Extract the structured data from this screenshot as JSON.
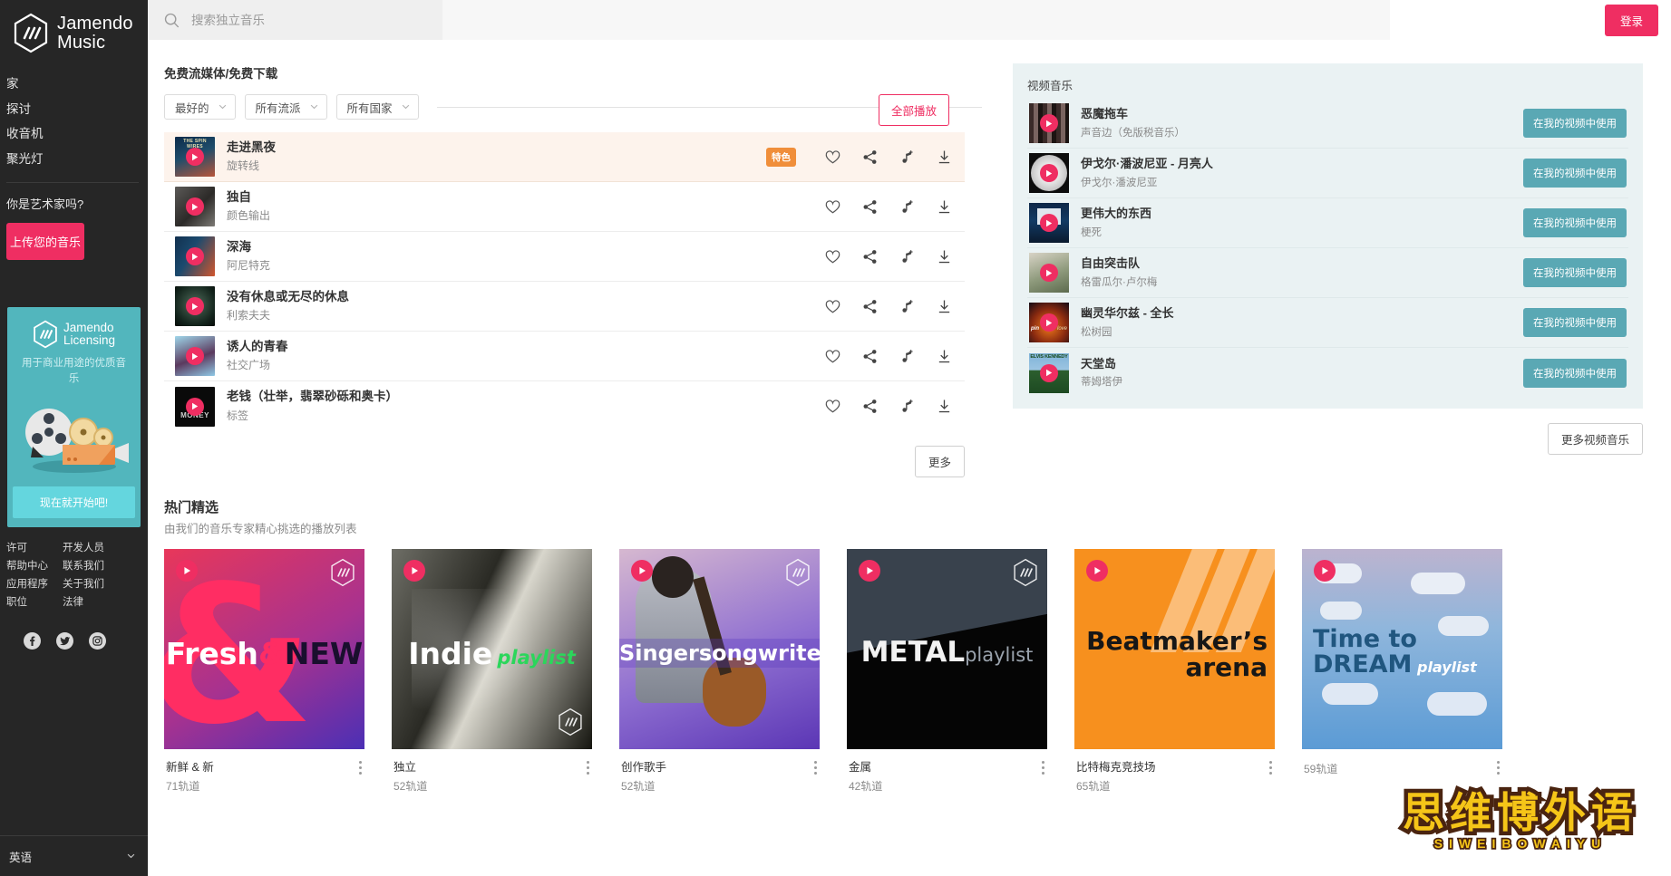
{
  "brand": {
    "line1": "Jamendo",
    "line2": "Music",
    "logo_icon": "jamendo-hex-logo"
  },
  "sidebar": {
    "nav": [
      {
        "label": "家",
        "name": "home"
      },
      {
        "label": "探讨",
        "name": "explore"
      },
      {
        "label": "收音机",
        "name": "radio"
      },
      {
        "label": "聚光灯",
        "name": "spotlight"
      }
    ],
    "artist_question": "你是艺术家吗?",
    "upload_label": "上传您的音乐",
    "promo": {
      "logo_line1": "Jamendo",
      "logo_line2": "Licensing",
      "subtitle": "用于商业用途的优质音乐",
      "cta": "现在就开始吧!"
    },
    "footer_links": [
      {
        "label": "许可"
      },
      {
        "label": "开发人员"
      },
      {
        "label": "帮助中心"
      },
      {
        "label": "联系我们"
      },
      {
        "label": "应用程序"
      },
      {
        "label": "关于我们"
      },
      {
        "label": "职位"
      },
      {
        "label": "法律"
      }
    ],
    "social": [
      {
        "name": "facebook-icon"
      },
      {
        "name": "twitter-icon"
      },
      {
        "name": "instagram-icon"
      }
    ],
    "language": "英语"
  },
  "topbar": {
    "search_placeholder": "搜索独立音乐",
    "search_value": "",
    "search_icon": "search-icon",
    "login_label": "登录"
  },
  "free_section": {
    "title": "免费流媒体/免费下载",
    "filters": [
      {
        "name": "sort",
        "value": "最好的"
      },
      {
        "name": "genre",
        "value": "所有流派"
      },
      {
        "name": "country",
        "value": "所有国家"
      }
    ],
    "play_all_label": "全部播放",
    "more_label": "更多",
    "featured_badge": "特色",
    "row_icons": [
      "heart-icon",
      "share-icon",
      "add-to-playlist-icon",
      "download-icon"
    ],
    "tracks": [
      {
        "title": "走进黑夜",
        "artist": "旋转线",
        "featured": true,
        "cover_label": "THE SPIN WIRES"
      },
      {
        "title": "独自",
        "artist": "颜色输出",
        "featured": false,
        "cover_label": ""
      },
      {
        "title": "深海",
        "artist": "阿尼特克",
        "featured": false,
        "cover_label": ""
      },
      {
        "title": "没有休息或无尽的休息",
        "artist": "利索夫夫",
        "featured": false,
        "cover_label": ""
      },
      {
        "title": "诱人的青春",
        "artist": "社交广场",
        "featured": false,
        "cover_label": ""
      },
      {
        "title": "老钱（壮举，翡翠砂砾和奥卡）",
        "artist": "标签",
        "featured": false,
        "cover_label": "MONEY"
      }
    ]
  },
  "video_section": {
    "title": "视频音乐",
    "more_label": "更多视频音乐",
    "use_label": "在我的视频中使用",
    "items": [
      {
        "title": "恶魔拖车",
        "artist": "声音边（免版税音乐）",
        "cover_label": ""
      },
      {
        "title": "伊戈尔·潘波尼亚 - 月亮人",
        "artist": "伊戈尔·潘波尼亚",
        "cover_label": "CD"
      },
      {
        "title": "更伟大的东西",
        "artist": "梗死",
        "cover_label": ""
      },
      {
        "title": "自由突击队",
        "artist": "格雷瓜尔·卢尔梅",
        "cover_label": ""
      },
      {
        "title": "幽灵华尔兹 - 全长",
        "artist": "松树园",
        "cover_label": "pin love"
      },
      {
        "title": "天堂岛",
        "artist": "蒂姆塔伊",
        "cover_label": "ELVIS KENNEDY"
      }
    ]
  },
  "playlists": {
    "heading": "热门精选",
    "subheading": "由我们的音乐专家精心挑选的播放列表",
    "cards": [
      {
        "art_text": "Fresh&NEW",
        "name": "新鲜 & 新",
        "count": "71轨道",
        "accent": "#ff2d63"
      },
      {
        "art_text": "Indie playlist",
        "name": "独立",
        "count": "52轨道",
        "accent": "#2bd65b"
      },
      {
        "art_text": "Singersongwriter",
        "name": "创作歌手",
        "count": "52轨道",
        "accent": "#7a5bd6"
      },
      {
        "art_text": "METALplaylist",
        "name": "金属",
        "count": "42轨道",
        "accent": "#39424d"
      },
      {
        "art_text": "Beatmaker's arena",
        "name": "比特梅克竞技场",
        "count": "65轨道",
        "accent": "#f7901e"
      },
      {
        "art_text": "Time to DREAM playlist",
        "name": "",
        "count": "59轨道",
        "accent": "#5b9bd5"
      }
    ]
  },
  "watermark": {
    "main": "思维博外语",
    "sub": "SIWEIBOWAIYU"
  }
}
